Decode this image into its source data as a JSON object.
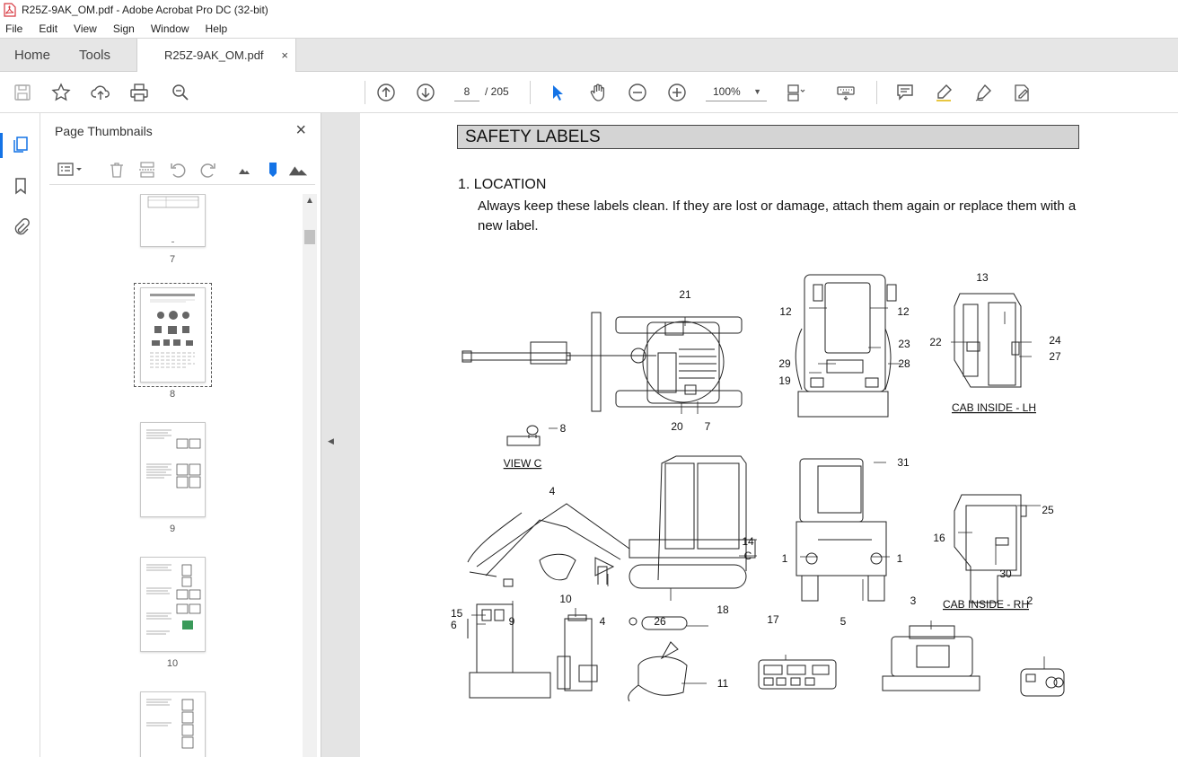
{
  "window": {
    "title": "R25Z-9AK_OM.pdf - Adobe Acrobat Pro DC (32-bit)"
  },
  "menu": [
    "File",
    "Edit",
    "View",
    "Sign",
    "Window",
    "Help"
  ],
  "tabs": {
    "home": "Home",
    "tools": "Tools",
    "document": "R25Z-9AK_OM.pdf",
    "close_glyph": "×"
  },
  "toolbar": {
    "current_page": "8",
    "page_total": "/ 205",
    "zoom": "100%"
  },
  "thumbnail_panel": {
    "title": "Page Thumbnails",
    "close_glyph": "×",
    "pages": [
      "7",
      "8",
      "9",
      "10"
    ]
  },
  "document": {
    "section_title": "SAFETY LABELS",
    "location_heading": "1.  LOCATION",
    "location_text": "Always keep these labels clean.  If they are lost or damage, attach them again or replace them with a new label.",
    "figure_labels": {
      "view_c": "VIEW C",
      "cab_lh": "CAB INSIDE - LH",
      "cab_rh": "CAB INSIDE - RH",
      "c": "C",
      "n1": "1",
      "n2": "2",
      "n3": "3",
      "n4": "4",
      "n5": "5",
      "n6": "6",
      "n7": "7",
      "n8": "8",
      "n9": "9",
      "n10": "10",
      "n11": "11",
      "n12": "12",
      "n13": "13",
      "n14": "14",
      "n15": "15",
      "n16": "16",
      "n17": "17",
      "n18": "18",
      "n19": "19",
      "n20": "20",
      "n21": "21",
      "n22": "22",
      "n23": "23",
      "n24": "24",
      "n25": "25",
      "n26": "26",
      "n27": "27",
      "n28": "28",
      "n29": "29",
      "n30": "30",
      "n31": "31"
    }
  },
  "colors": {
    "accent": "#1473e6",
    "pdf_red": "#d7373f",
    "section_bg": "#d4d4d4"
  }
}
